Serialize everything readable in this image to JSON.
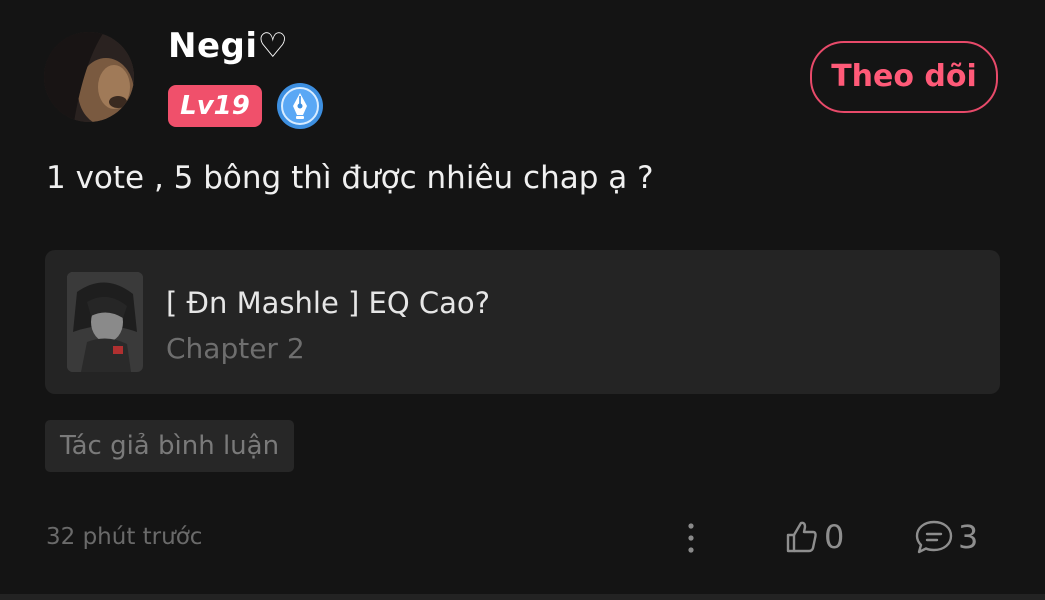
{
  "author": {
    "name": "Negi♡",
    "level": "Lv19"
  },
  "follow_label": "Theo dõi",
  "post": {
    "text": "1 vote , 5 bông thì được nhiêu chap ạ ?"
  },
  "story": {
    "title": "[ Đn Mashle ] EQ Cao?",
    "chapter": "Chapter 2"
  },
  "author_tag": "Tác giả bình luận",
  "footer": {
    "timestamp": "32 phút trước",
    "likes": "0",
    "comments": "3"
  },
  "colors": {
    "accent": "#ff5a78",
    "badge": "#f0506b",
    "background": "#141414"
  },
  "icons": {
    "writer_badge": "pen-nib-icon",
    "more": "more-vertical-icon",
    "like": "thumbs-up-icon",
    "comment": "chat-bubble-icon"
  }
}
